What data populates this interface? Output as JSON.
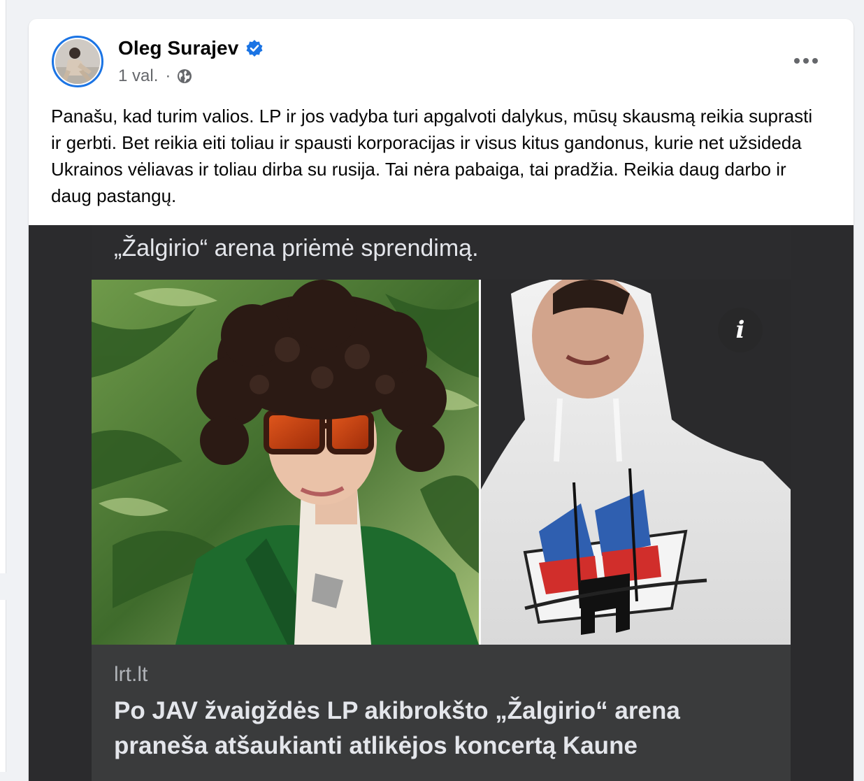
{
  "post": {
    "author": {
      "name": "Oleg Surajev",
      "verified": true
    },
    "time": "1 val.",
    "separator": "·",
    "audience_icon": "globe-icon",
    "more_icon": "more-options-icon",
    "text": "Panašu, kad turim valios. LP ir jos vadyba turi apgalvoti dalykus, mūsų skausmą reikia suprasti ir gerbti. Bet reikia eiti toliau ir spausti korporacijas ir visus kitus gandonus, kurie net užsideda Ukrainos vėliavas ir toliau dirba su rusija. Tai nėra pabaiga, tai pradžia. Reikia daug darbo ir daug pastangų."
  },
  "attachment": {
    "top_caption": "„Žalgirio“ arena priėmė sprendimą.",
    "info_label": "i",
    "link_domain": "lrt.lt",
    "link_headline": "Po JAV žvaigždės LP akibrokšto „Žalgirio“ arena praneša atšaukianti atlikėjos koncertą Kaune"
  },
  "colors": {
    "accent": "#1b74e4",
    "text_primary": "#050505",
    "text_secondary": "#65676b",
    "background": "#f0f2f5"
  }
}
